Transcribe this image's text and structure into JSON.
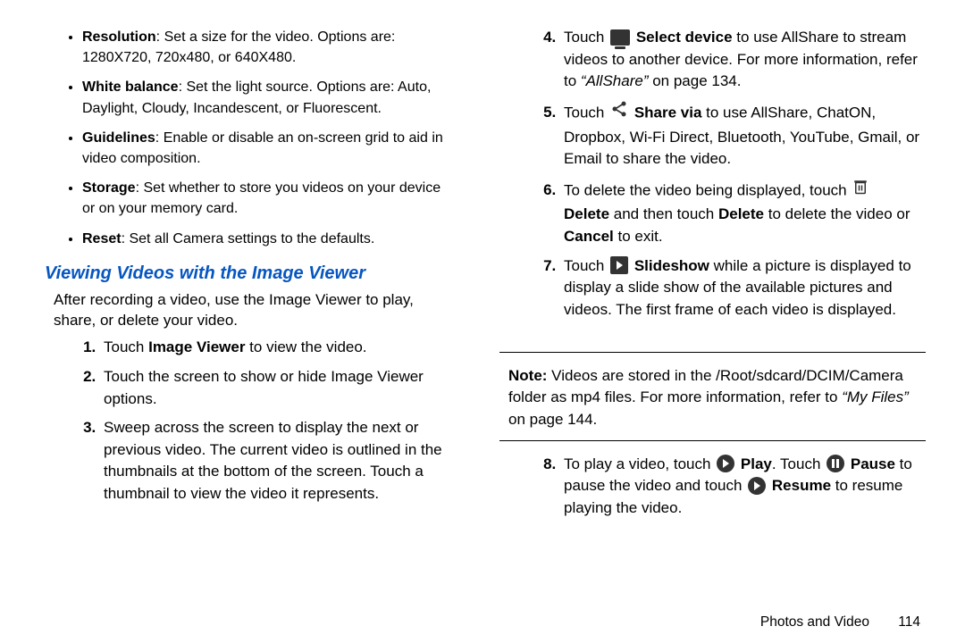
{
  "bullets": [
    {
      "label": "Resolution",
      "text": ": Set a size for the video. Options are: 1280X720, 720x480, or 640X480."
    },
    {
      "label": "White balance",
      "text": ": Set the light source. Options are: Auto, Daylight, Cloudy, Incandescent, or Fluorescent."
    },
    {
      "label": "Guidelines",
      "text": ": Enable or disable an on-screen grid to aid in video composition."
    },
    {
      "label": "Storage",
      "text": ": Set whether to store you videos on your device or on your memory card."
    },
    {
      "label": "Reset",
      "text": ": Set all Camera settings to the defaults."
    }
  ],
  "heading": "Viewing Videos with the Image Viewer",
  "intro": "After recording a video, use the Image Viewer to play, share, or delete your video.",
  "stepsLeft": {
    "s1a": "Touch ",
    "s1b": "Image Viewer",
    "s1c": " to view the video.",
    "s2": "Touch the screen to show or hide Image Viewer options.",
    "s3": "Sweep across the screen to display the next or previous video. The current video is outlined in the thumbnails at the bottom of the screen. Touch a thumbnail to view the video it represents."
  },
  "stepsRight": {
    "s4a": "Touch ",
    "s4b": "Select device",
    "s4c": " to use AllShare to stream videos to another device. For more information, refer to ",
    "s4link": "“AllShare”",
    "s4d": " on page 134.",
    "s5a": "Touch ",
    "s5b": "Share via",
    "s5c": " to use AllShare, ChatON, Dropbox, Wi-Fi Direct, Bluetooth, YouTube, Gmail, or Email to share the video.",
    "s6a": "To delete the video being displayed, touch ",
    "s6b": "Delete",
    "s6c": " and then touch ",
    "s6d": "Delete",
    "s6e": " to delete the video or ",
    "s6f": "Cancel",
    "s6g": " to exit.",
    "s7a": "Touch ",
    "s7b": "Slideshow",
    "s7c": " while a picture is displayed to display a slide show of the available pictures and videos. The first frame of each video is displayed."
  },
  "noteLabel": "Note:",
  "noteText": " Videos are stored in the /Root/sdcard/DCIM/Camera folder as mp4 files. For more information, refer to ",
  "noteLink": "“My Files”",
  "noteTail": " on page 144.",
  "step8": {
    "a": "To play a video, touch ",
    "play": "Play",
    "b": ". Touch ",
    "pause": "Pause",
    "c": " to pause the video and touch ",
    "resume": "Resume",
    "d": " to resume playing the video."
  },
  "footer": {
    "section": "Photos and Video",
    "page": "114"
  }
}
